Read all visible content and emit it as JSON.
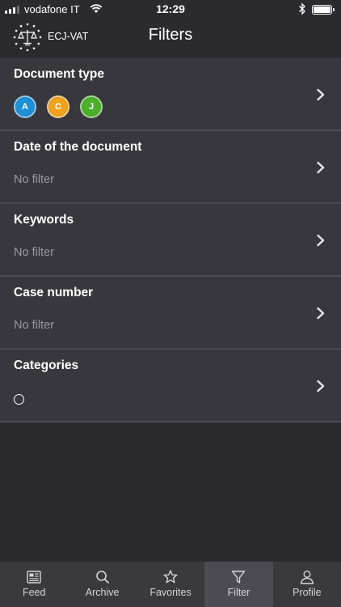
{
  "status_bar": {
    "carrier": "vodafone IT",
    "time": "12:29",
    "battery_level": 1.0
  },
  "nav": {
    "app_name": "ECJ-VAT",
    "title": "Filters"
  },
  "filters": [
    {
      "title": "Document type",
      "badges": [
        {
          "letter": "A",
          "color": "#1e90d6"
        },
        {
          "letter": "C",
          "color": "#f0a21b"
        },
        {
          "letter": "J",
          "color": "#4caf2a"
        }
      ]
    },
    {
      "title": "Date of the document",
      "value": "No filter"
    },
    {
      "title": "Keywords",
      "value": "No filter"
    },
    {
      "title": "Case number",
      "value": "No filter"
    },
    {
      "title": "Categories"
    }
  ],
  "tabs": [
    {
      "label": "Feed",
      "icon": "newspaper-icon",
      "active": false
    },
    {
      "label": "Archive",
      "icon": "search-icon",
      "active": false
    },
    {
      "label": "Favorites",
      "icon": "star-icon",
      "active": false
    },
    {
      "label": "Filter",
      "icon": "filter-icon",
      "active": true
    },
    {
      "label": "Profile",
      "icon": "person-icon",
      "active": false
    }
  ],
  "colors": {
    "background": "#2b2a2f",
    "row_background": "#38373d",
    "tab_bar": "#3a393e",
    "tab_active": "#4c4b51"
  }
}
